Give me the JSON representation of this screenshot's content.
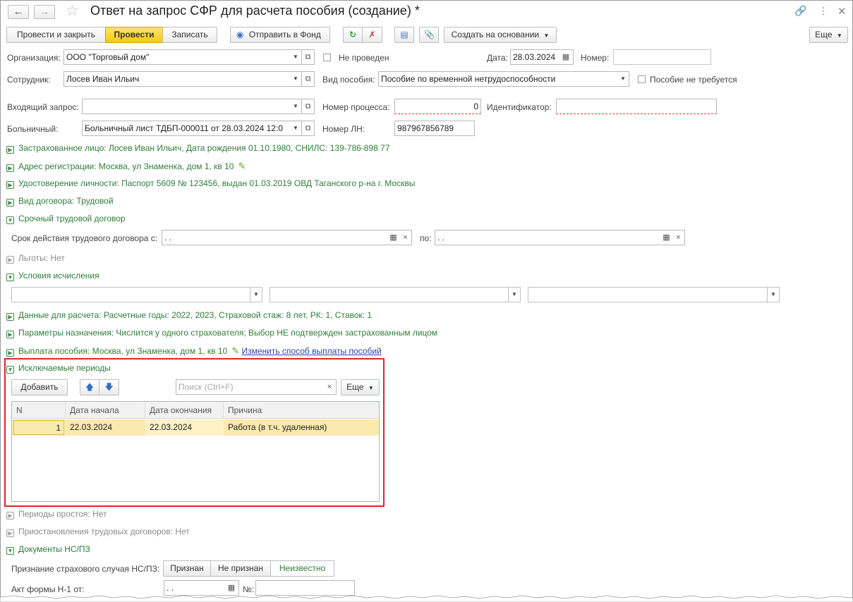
{
  "window": {
    "title": "Ответ на запрос СФР для расчета пособия (создание) *"
  },
  "toolbar": {
    "post_close": "Провести и закрыть",
    "post": "Провести",
    "save": "Записать",
    "send_fund": "Отправить в Фонд",
    "create_based": "Создать на основании",
    "more": "Еще"
  },
  "header": {
    "org_label": "Организация:",
    "org_value": "ООО \"Торговый дом\"",
    "not_posted": "Не проведен",
    "date_label": "Дата:",
    "date_value": "28.03.2024",
    "number_label": "Номер:",
    "number_value": "",
    "employee_label": "Сотрудник:",
    "employee_value": "Лосев Иван Ильич",
    "benefit_type_label": "Вид пособия:",
    "benefit_type_value": "Пособие по временной нетрудоспособности",
    "no_benefit_label": "Пособие не требуется",
    "incoming_label": "Входящий запрос:",
    "incoming_value": "",
    "process_label": "Номер процесса:",
    "process_value": "0",
    "ident_label": "Идентификатор:",
    "ident_value": "",
    "sick_label": "Больничный:",
    "sick_value": "Больничный лист ТДБП-000011 от 28.03.2024 12:0",
    "ln_label": "Номер ЛН:",
    "ln_value": "987967856789"
  },
  "groups": {
    "insured": "Застрахованное лицо: Лосев Иван Ильич, Дата рождения 01.10.1980, СНИЛС: 139-786-898 77",
    "address": "Адрес регистрации: Москва, ул Знаменка, дом 1, кв 10",
    "identity": "Удостоверение личности: Паспорт 5609 № 123456, выдан 01.03.2019 ОВД Таганского р-на г. Москвы",
    "contract_kind": "Вид договора: Трудовой",
    "fixed_term": "Срочный трудовой договор",
    "contract_from_label": "Срок действия трудового договора с:",
    "contract_from_value": " .  .",
    "contract_to_label": "по:",
    "contract_to_value": " .  .",
    "benefits": "Льготы: Нет",
    "calc_conditions": "Условия исчисления",
    "calc_data": "Данные для расчета: Расчетные годы: 2022, 2023, Страховой стаж: 8 лет, РК: 1, Ставок: 1",
    "params": "Параметры назначения: Числится у одного страхователя; Выбор НЕ подтвержден застрахованным лицом",
    "payment": "Выплата пособия: Москва, ул Знаменка, дом 1, кв 10",
    "payment_link": "Изменить способ выплаты пособий",
    "excluded": "Исключаемые периоды",
    "idle": "Периоды простоя: Нет",
    "suspension": "Приостановления трудовых договоров: Нет",
    "docs": "Документы НС/ПЗ",
    "recognition_label": "Признание страхового случая НС/ПЗ:",
    "act_label": "Акт формы Н-1 от:",
    "act_value": " .  .",
    "act_no_label": "№:"
  },
  "recognition_options": [
    "Признан",
    "Не признан",
    "Неизвестно"
  ],
  "excluded_table": {
    "add_button": "Добавить",
    "search_placeholder": "Поиск (Ctrl+F)",
    "more": "Еще",
    "columns": [
      "N",
      "Дата начала",
      "Дата окончания",
      "Причина"
    ],
    "rows": [
      {
        "n": "1",
        "start": "22.03.2024",
        "end": "22.03.2024",
        "reason": "Работа (в т.ч. удаленная)"
      }
    ]
  },
  "colors": {
    "accent_green": "#2f7d3a",
    "highlight_red": "#e32424",
    "selected_row": "#fbeaae",
    "primary_button": "#f6c915"
  }
}
